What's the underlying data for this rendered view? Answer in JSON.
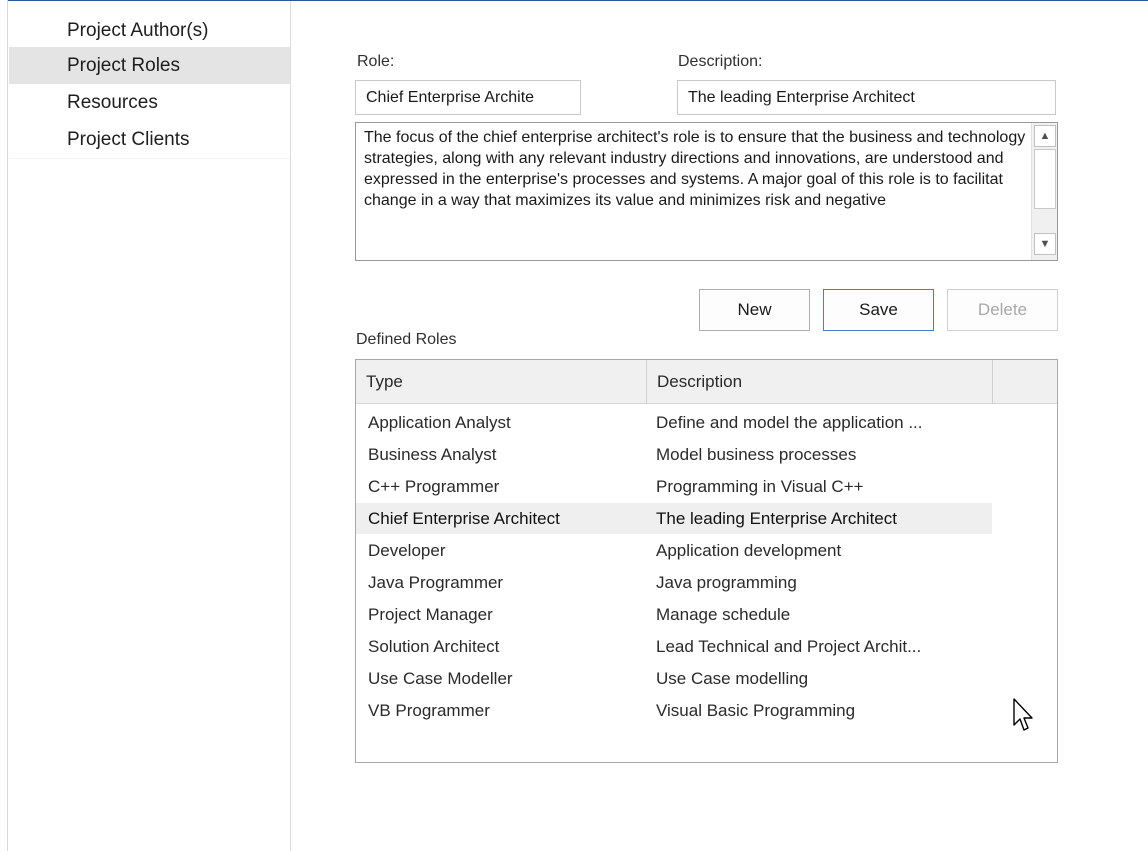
{
  "sidebar": {
    "items": [
      {
        "label": "Project Author(s)"
      },
      {
        "label": "Project Roles"
      },
      {
        "label": "Resources"
      },
      {
        "label": "Project Clients"
      }
    ]
  },
  "form": {
    "role_label": "Role:",
    "role_value": "Chief Enterprise Archite",
    "description_label": "Description:",
    "description_value": "The leading Enterprise Architect",
    "notes": "The focus of the chief enterprise architect's role is to ensure that the business and technology strategies, along with any relevant industry directions and innovations, are understood and expressed in the enterprise's processes and systems. A major goal of this role is to facilitat change in a way that maximizes its value and minimizes risk and negative"
  },
  "buttons": {
    "new": "New",
    "save": "Save",
    "delete": "Delete"
  },
  "roles": {
    "section_label": "Defined Roles",
    "columns": {
      "type": "Type",
      "description": "Description"
    },
    "rows": [
      {
        "type": "Application Analyst",
        "description": "Define and model the application ..."
      },
      {
        "type": "Business Analyst",
        "description": "Model business processes"
      },
      {
        "type": "C++ Programmer",
        "description": "Programming in Visual C++"
      },
      {
        "type": "Chief Enterprise Architect",
        "description": "The leading Enterprise Architect",
        "selected": true
      },
      {
        "type": "Developer",
        "description": "Application development"
      },
      {
        "type": "Java Programmer",
        "description": "Java programming"
      },
      {
        "type": "Project Manager",
        "description": "Manage schedule"
      },
      {
        "type": "Solution Architect",
        "description": "Lead Technical and Project Archit..."
      },
      {
        "type": "Use Case Modeller",
        "description": "Use Case modelling"
      },
      {
        "type": "VB Programmer",
        "description": "Visual Basic Programming"
      }
    ]
  },
  "icons": {
    "scroll_up": "scroll-up-arrow-icon",
    "scroll_down": "scroll-down-arrow-icon",
    "cursor": "mouse-pointer-icon"
  },
  "colors": {
    "frame_accent": "#2b5797",
    "selected_row": "#efefef",
    "sidebar_selected": "#e4e4e4"
  }
}
